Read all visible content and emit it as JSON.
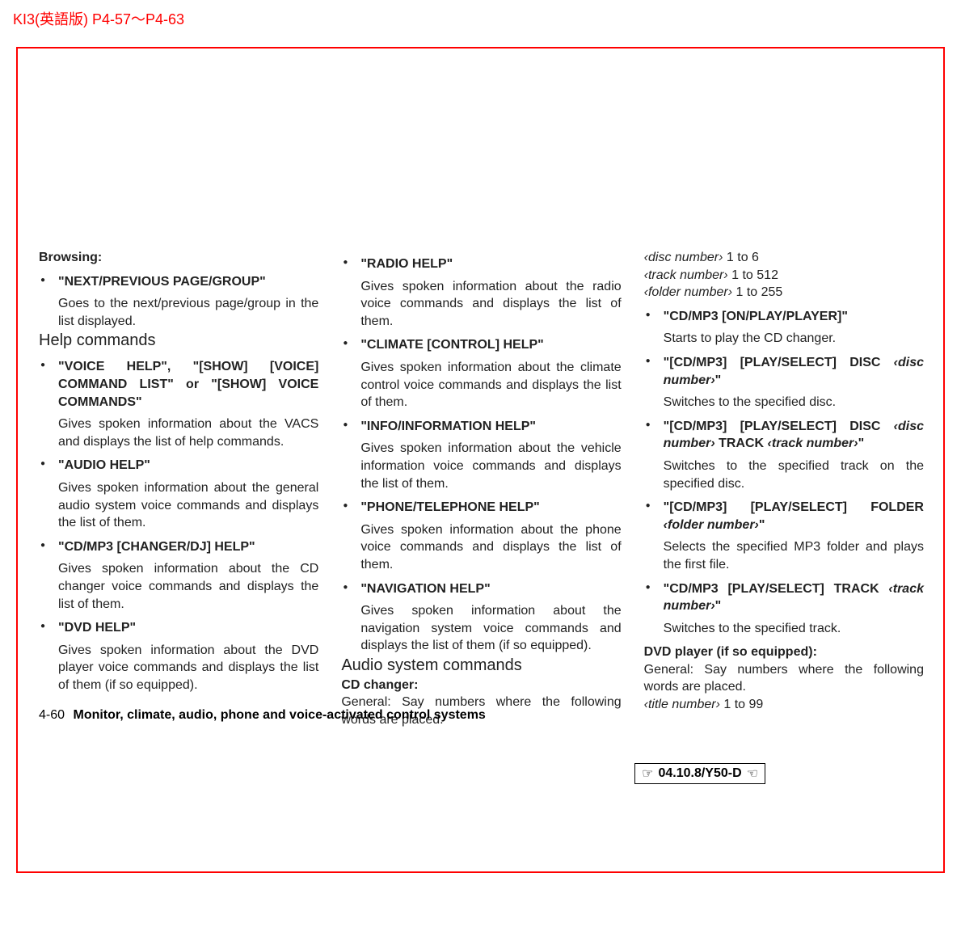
{
  "top_label": "KI3(英語版) P4-57〜P4-63",
  "col1": {
    "browsing_head": "Browsing:",
    "b1_cmd": "\"NEXT/PREVIOUS PAGE/GROUP\"",
    "b1_desc": "Goes to the next/previous page/group in the list displayed.",
    "help_head": "Help commands",
    "h1_cmd": "\"VOICE HELP\", \"[SHOW] [VOICE] COMMAND LIST\" or \"[SHOW] VOICE COMMANDS\"",
    "h1_desc": "Gives spoken information about the VACS and displays the list of help commands.",
    "h2_cmd": "\"AUDIO HELP\"",
    "h2_desc": "Gives spoken information about the general audio system voice commands and displays the list of them.",
    "h3_cmd": "\"CD/MP3 [CHANGER/DJ] HELP\"",
    "h3_desc": "Gives spoken information about the CD changer voice commands and displays the list of them.",
    "h4_cmd": "\"DVD HELP\"",
    "h4_desc": "Gives spoken information about the DVD player voice commands and displays the list of them (if so equipped)."
  },
  "col2": {
    "r1_cmd": "\"RADIO HELP\"",
    "r1_desc": "Gives spoken information about the radio voice commands and displays the list of them.",
    "r2_cmd": "\"CLIMATE [CONTROL] HELP\"",
    "r2_desc": "Gives spoken information about the climate control voice commands and displays the list of them.",
    "r3_cmd": "\"INFO/INFORMATION HELP\"",
    "r3_desc": "Gives spoken information about the vehicle information voice commands and displays the list of them.",
    "r4_cmd": "\"PHONE/TELEPHONE HELP\"",
    "r4_desc": "Gives spoken information about the phone voice commands and displays the list of them.",
    "r5_cmd": "\"NAVIGATION HELP\"",
    "r5_desc": "Gives spoken information about the navigation system voice commands and displays the list of them (if so equipped).",
    "audio_head": "Audio system commands",
    "cd_head": "CD changer:",
    "cd_general": "General: Say numbers where the following words are placed."
  },
  "col3": {
    "p_disc_a": "‹disc number›",
    "p_disc_b": " 1 to 6",
    "p_track_a": "‹track number›",
    "p_track_b": " 1 to 512",
    "p_folder_a": "‹folder number›",
    "p_folder_b": " 1 to 255",
    "c1_cmd": "\"CD/MP3 [ON/PLAY/PLAYER]\"",
    "c1_desc": "Starts to play the CD changer.",
    "c2_a": "\"[CD/MP3] [PLAY/SELECT] DISC ",
    "c2_b": "‹disc number›",
    "c2_c": "\"",
    "c2_desc": "Switches to the specified disc.",
    "c3_a": "\"[CD/MP3] [PLAY/SELECT] DISC ",
    "c3_b": "‹disc number›",
    "c3_c": " TRACK ",
    "c3_d": "‹track number›",
    "c3_e": "\"",
    "c3_desc": "Switches to the specified track on the specified disc.",
    "c4_a": "\"[CD/MP3] [PLAY/SELECT] FOLDER ",
    "c4_b": "‹folder number›",
    "c4_c": "\"",
    "c4_desc": "Selects the specified MP3 folder and plays the first file.",
    "c5_a": "\"CD/MP3 [PLAY/SELECT] TRACK ",
    "c5_b": "‹track number›",
    "c5_c": "\"",
    "c5_desc": "Switches to the specified track.",
    "dvd_head": "DVD player (if so equipped):",
    "dvd_general": "General: Say numbers where the following words are placed.",
    "p_title_a": "‹title number›",
    "p_title_b": " 1 to 99"
  },
  "footer": {
    "page_no": "4-60",
    "title": "Monitor, climate, audio, phone and voice-activated control systems"
  },
  "stamp": "04.10.8/Y50-D"
}
